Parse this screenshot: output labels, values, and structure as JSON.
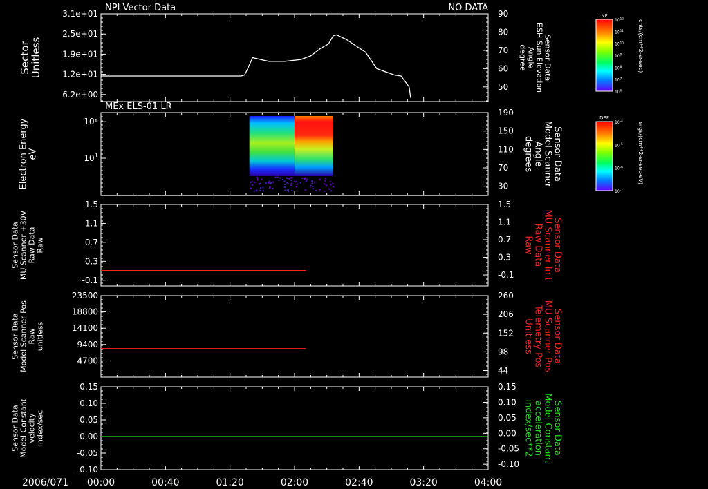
{
  "colors": {
    "white": "#ffffff",
    "red": "#ff2020",
    "green": "#22dd22",
    "background": "#000000"
  },
  "chart_data": [
    {
      "type": "line",
      "title_left": "NPI Vector Data",
      "title_right": "NO DATA",
      "ylabel_left": [
        "Sector",
        "Unitless"
      ],
      "ylabel_right": [
        "Sensor Data",
        "ESH Sun Elevation",
        "Angle",
        "degree"
      ],
      "yticks_left": [
        "3.1e+01",
        "2.5e+01",
        "1.9e+01",
        "1.2e+01",
        "6.2e+00"
      ],
      "yticks_right": [
        "90",
        "80",
        "70",
        "60",
        "50"
      ],
      "ylim_right": [
        42,
        90
      ],
      "series": [
        {
          "color": "#ffffff",
          "x": [
            0,
            84,
            87,
            89,
            91,
            94,
            104,
            114,
            124,
            130,
            133,
            136,
            141,
            144,
            146,
            152,
            164,
            171,
            182,
            186,
            191,
            192
          ],
          "y": [
            56,
            56,
            56,
            56.5,
            60,
            66,
            64,
            64,
            65,
            67,
            69,
            71,
            73.5,
            78,
            78.5,
            76,
            69,
            60,
            56.5,
            56,
            50,
            44
          ]
        }
      ],
      "colorbar": {
        "label": "NF",
        "unit": "cnts/(cm**2-sr-sec)",
        "ticks": [
          "10^12",
          "10^11",
          "10^10",
          "10^9",
          "10^8",
          "10^7",
          "10^6"
        ]
      }
    },
    {
      "type": "heatmap",
      "title_left": "MEx ELS-01 LR",
      "ylabel_left": [
        "Electron Energy",
        "eV"
      ],
      "ylabel_right": [
        "Sensor Data",
        "Model Scanner",
        "Angle",
        "degrees"
      ],
      "yticks_left": [
        "10^2",
        "10^1"
      ],
      "yticks_right": [
        "190",
        "150",
        "110",
        "70",
        "30"
      ],
      "ylim_right": [
        10,
        190
      ],
      "data_extent": {
        "x": [
          "01:32",
          "02:24"
        ]
      },
      "scanner_angle_series": {
        "color": "#ffffff",
        "x": [
          0,
          192
        ],
        "y": [
          10,
          10
        ]
      },
      "colorbar": {
        "label": "DEF",
        "unit": "ergs/(cm**2-sr-sec-eV)",
        "ticks": [
          "10^-4",
          "10^-5",
          "10^-6",
          "10^-7"
        ]
      }
    },
    {
      "type": "line",
      "ylabel_left": [
        "Sensor Data",
        "MU Scanner +30V",
        "Raw Data",
        "Raw"
      ],
      "ylabel_right": [
        "Sensor Data",
        "MU Scanner Init",
        "Raw Data",
        "Raw"
      ],
      "yticks_left": [
        "1.5",
        "1.1",
        "0.7",
        "0.3",
        "-0.1"
      ],
      "yticks_right": [
        "1.5",
        "1.1",
        "0.7",
        "0.3",
        "-0.1"
      ],
      "ylim_right": [
        -0.35,
        1.5
      ],
      "series": [
        {
          "color": "#ff2020",
          "x": [
            0,
            127
          ],
          "y": [
            0.0,
            0.0
          ]
        }
      ]
    },
    {
      "type": "line",
      "ylabel_left": [
        "Sensor Data",
        "Model Scanner Pos",
        "Raw",
        "unitless"
      ],
      "ylabel_right": [
        "Sensor Data",
        "MU Scanner Pos",
        "Telemetry Pos",
        "Unitless"
      ],
      "yticks_left": [
        "23500",
        "18800",
        "14100",
        "9400",
        "4700"
      ],
      "yticks_right": [
        "260",
        "206",
        "152",
        "98",
        "44"
      ],
      "ylim_left": [
        0,
        23500
      ],
      "series": [
        {
          "color": "#ff2020",
          "x": [
            0,
            127
          ],
          "y": [
            8200,
            8200
          ]
        }
      ]
    },
    {
      "type": "line",
      "ylabel_left": [
        "Sensor Data",
        "Model Constant",
        "velocity",
        "index/sec"
      ],
      "ylabel_right": [
        "Sensor Data",
        "Model Constant",
        "acceleration",
        "index/sec**2"
      ],
      "yticks_left": [
        "0.15",
        "0.10",
        "0.05",
        "0.00",
        "-0.05",
        "-0.10"
      ],
      "yticks_right": [
        "0.15",
        "0.10",
        "0.05",
        "0.00",
        "-0.05",
        "-0.10"
      ],
      "ylim_left": [
        -0.1,
        0.15
      ],
      "series": [
        {
          "color": "#22dd22",
          "x": [
            0,
            240
          ],
          "y": [
            0,
            0
          ]
        }
      ]
    }
  ],
  "x_axis": {
    "date_label": "2006/071",
    "tick_labels": [
      "00:00",
      "00:40",
      "01:20",
      "02:00",
      "02:40",
      "03:20",
      "04:00"
    ]
  }
}
